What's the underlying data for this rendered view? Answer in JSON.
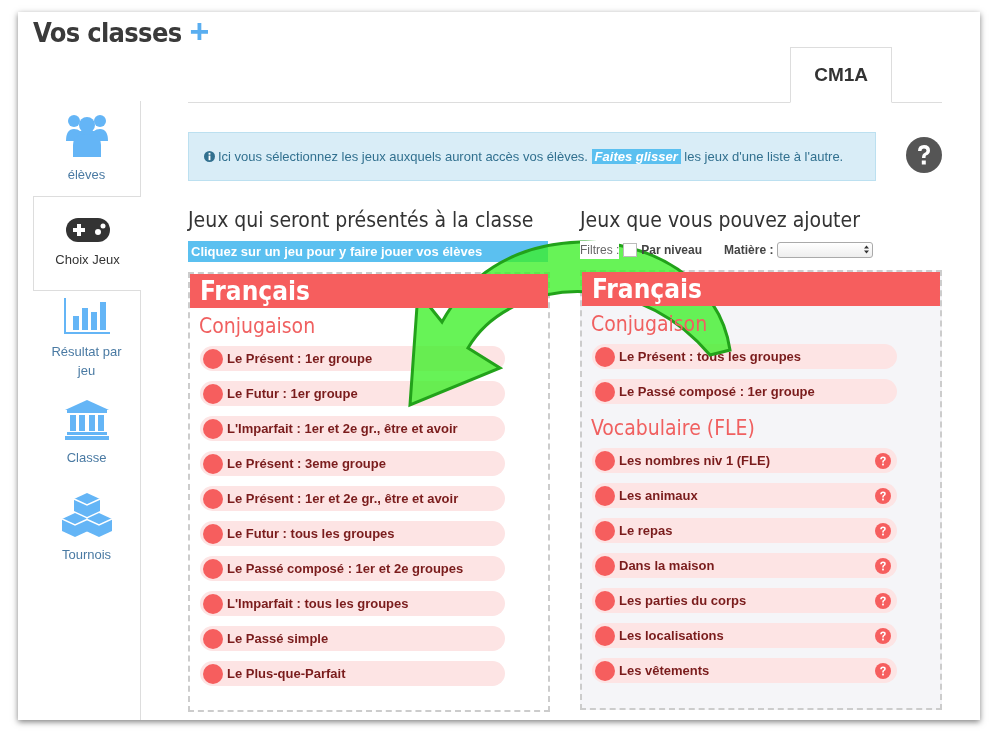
{
  "page_title": "Vos classes",
  "add_button": "+",
  "tabs": [
    {
      "label": "CM1A",
      "selected": true
    }
  ],
  "sidebar": [
    {
      "label": "élèves",
      "selected": false
    },
    {
      "label": "Choix Jeux",
      "selected": true
    },
    {
      "label": "Résultat par jeu",
      "selected": false
    },
    {
      "label": "Classe",
      "selected": false
    },
    {
      "label": "Tournois",
      "selected": false
    }
  ],
  "info": {
    "before": "Ici vous sélectionnez les jeux auxquels auront accès vos élèves.",
    "highlight": "Faites glisser",
    "after": "les jeux d'une liste à l'autre."
  },
  "left": {
    "heading": "Jeux qui seront présentés à la classe",
    "hint": "Cliquez sur un jeu pour y faire jouer vos élèves",
    "subjects": [
      {
        "name": "Français",
        "sections": [
          {
            "name": "Conjugaison",
            "games": [
              {
                "label": "Le Présent : 1er groupe",
                "help": false
              },
              {
                "label": "Le Futur : 1er groupe",
                "help": false
              },
              {
                "label": "L'Imparfait : 1er et 2e gr., être et avoir",
                "help": false
              },
              {
                "label": "Le Présent : 3eme groupe",
                "help": false
              },
              {
                "label": "Le Présent : 1er et 2e gr., être et avoir",
                "help": false
              },
              {
                "label": "Le Futur : tous les groupes",
                "help": false
              },
              {
                "label": "Le Passé composé : 1er et 2e groupes",
                "help": false
              },
              {
                "label": "L'Imparfait : tous les groupes",
                "help": false
              },
              {
                "label": "Le Passé simple",
                "help": false
              },
              {
                "label": "Le Plus-que-Parfait",
                "help": false
              }
            ]
          }
        ]
      }
    ]
  },
  "right": {
    "heading": "Jeux que vous pouvez ajouter",
    "filters": {
      "label": "Filtres :",
      "level_label": "Par niveau",
      "level_checked": false,
      "subject_label": "Matière :"
    },
    "subjects": [
      {
        "name": "Français",
        "sections": [
          {
            "name": "Conjugaison",
            "games": [
              {
                "label": "Le Présent : tous les groupes",
                "help": false
              },
              {
                "label": "Le Passé composé : 1er groupe",
                "help": false
              }
            ]
          },
          {
            "name": "Vocabulaire (FLE)",
            "games": [
              {
                "label": "Les nombres niv 1 (FLE)",
                "help": true
              },
              {
                "label": "Les animaux",
                "help": true
              },
              {
                "label": "Le repas",
                "help": true
              },
              {
                "label": "Dans la maison",
                "help": true
              },
              {
                "label": "Les parties du corps",
                "help": true
              },
              {
                "label": "Les localisations",
                "help": true
              },
              {
                "label": "Les vêtements",
                "help": true
              }
            ]
          }
        ]
      }
    ]
  }
}
